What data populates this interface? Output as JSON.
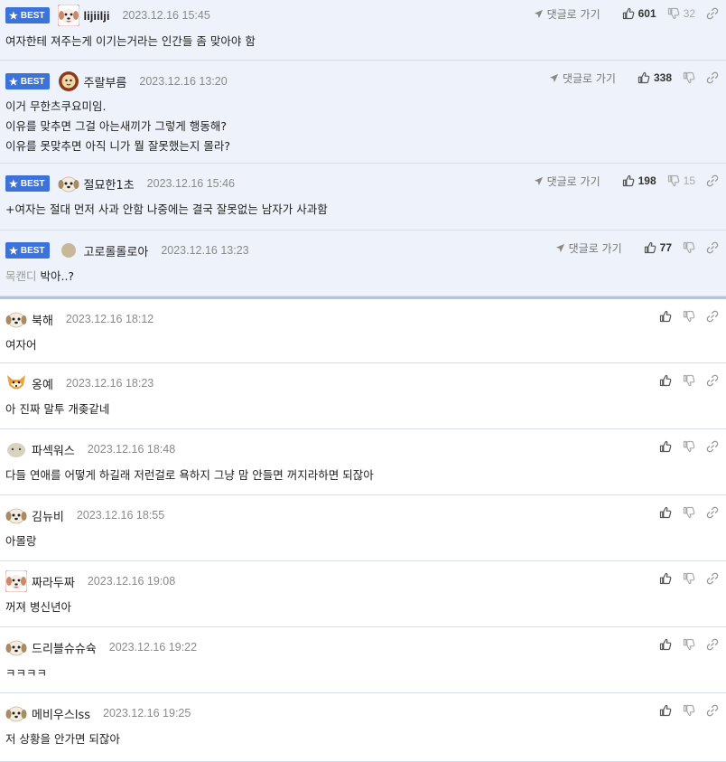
{
  "best_badge_label": "BEST",
  "reply_label": "댓글로 가기",
  "colors": {
    "accent": "#3d73d8",
    "best_bg": "#eef2fb"
  },
  "best_comments": [
    {
      "nick": "lijiilji",
      "date": "2023.12.16 15:45",
      "up": "601",
      "down": "32",
      "avatar": "dog-red-avatar",
      "lines": [
        "여자한테 져주는게 이기는거라는 인간들 좀 맞아야 함"
      ]
    },
    {
      "nick": "주랄부름",
      "date": "2023.12.16 13:20",
      "up": "338",
      "down": "",
      "avatar": "lion-avatar",
      "lines": [
        "이거 무한츠쿠요미임.",
        "이유를 맞추면 그걸 아는새끼가 그렇게 행동해?",
        "이유를 못맞추면 아직 니가 뭘 잘못했는지 몰라?"
      ]
    },
    {
      "nick": "절묘한1초",
      "date": "2023.12.16 15:46",
      "up": "198",
      "down": "15",
      "avatar": "puppy-avatar",
      "lines": [
        "+여자는 절대 먼저 사과 안함 나중에는 결국 잘못없는 남자가 사과함"
      ]
    },
    {
      "nick": "고로롤롤로아",
      "date": "2023.12.16 13:23",
      "up": "77",
      "down": "",
      "avatar": "circle-avatar",
      "muted_prefix": "목캔디 ",
      "lines": [
        "박아..?"
      ]
    }
  ],
  "comments": [
    {
      "nick": "북해",
      "date": "2023.12.16 18:12",
      "avatar": "puppy-avatar",
      "text": "여자어"
    },
    {
      "nick": "옹예",
      "date": "2023.12.16 18:23",
      "avatar": "fox-avatar",
      "text": "아 진짜 말투 개좆같네"
    },
    {
      "nick": "파섹워스",
      "date": "2023.12.16 18:48",
      "avatar": "blob-avatar",
      "text": "다들 연애를 어떻게 하길래 저런걸로 욕하지 그냥 맘 안들면 꺼지라하면 되잖아"
    },
    {
      "nick": "김뉴비",
      "date": "2023.12.16 18:55",
      "avatar": "puppy-avatar",
      "text": "아몰랑"
    },
    {
      "nick": "짜라두짜",
      "date": "2023.12.16 19:08",
      "avatar": "dog-red-avatar",
      "text": "꺼져 병신년아"
    },
    {
      "nick": "드리블슈슈슉",
      "date": "2023.12.16 19:22",
      "avatar": "puppy-avatar",
      "text": "ㅋㅋㅋㅋ"
    },
    {
      "nick": "메비우스lss",
      "date": "2023.12.16 19:25",
      "avatar": "puppy-avatar",
      "text": "저 상황을 안가면 되잖아"
    }
  ]
}
